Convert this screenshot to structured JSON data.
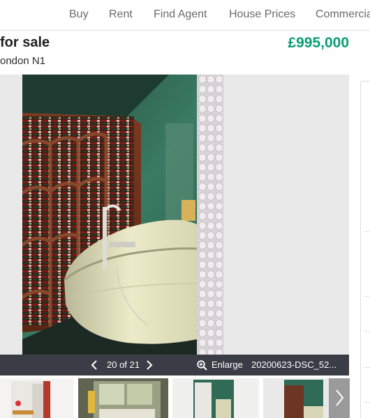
{
  "nav": {
    "items": [
      {
        "label": "Buy"
      },
      {
        "label": "Rent"
      },
      {
        "label": "Find Agent"
      },
      {
        "label": "House Prices"
      },
      {
        "label": "Commercial"
      }
    ]
  },
  "listing": {
    "title": "for sale",
    "location": "ondon N1",
    "price": "£995,000"
  },
  "gallery": {
    "counter": "20 of 21",
    "enlarge_label": "Enlarge",
    "filename": "20200623-DSC_52...",
    "prev_icon": "chevron-left-icon",
    "next_icon": "chevron-right-icon",
    "enlarge_icon": "zoom-in-icon"
  },
  "thumbnails": {
    "count": 4,
    "next_icon": "chevron-right-icon"
  },
  "colors": {
    "price": "#0b9d74",
    "gallery_bar": "#3a3d45",
    "wall_green": "#2f6b57"
  }
}
